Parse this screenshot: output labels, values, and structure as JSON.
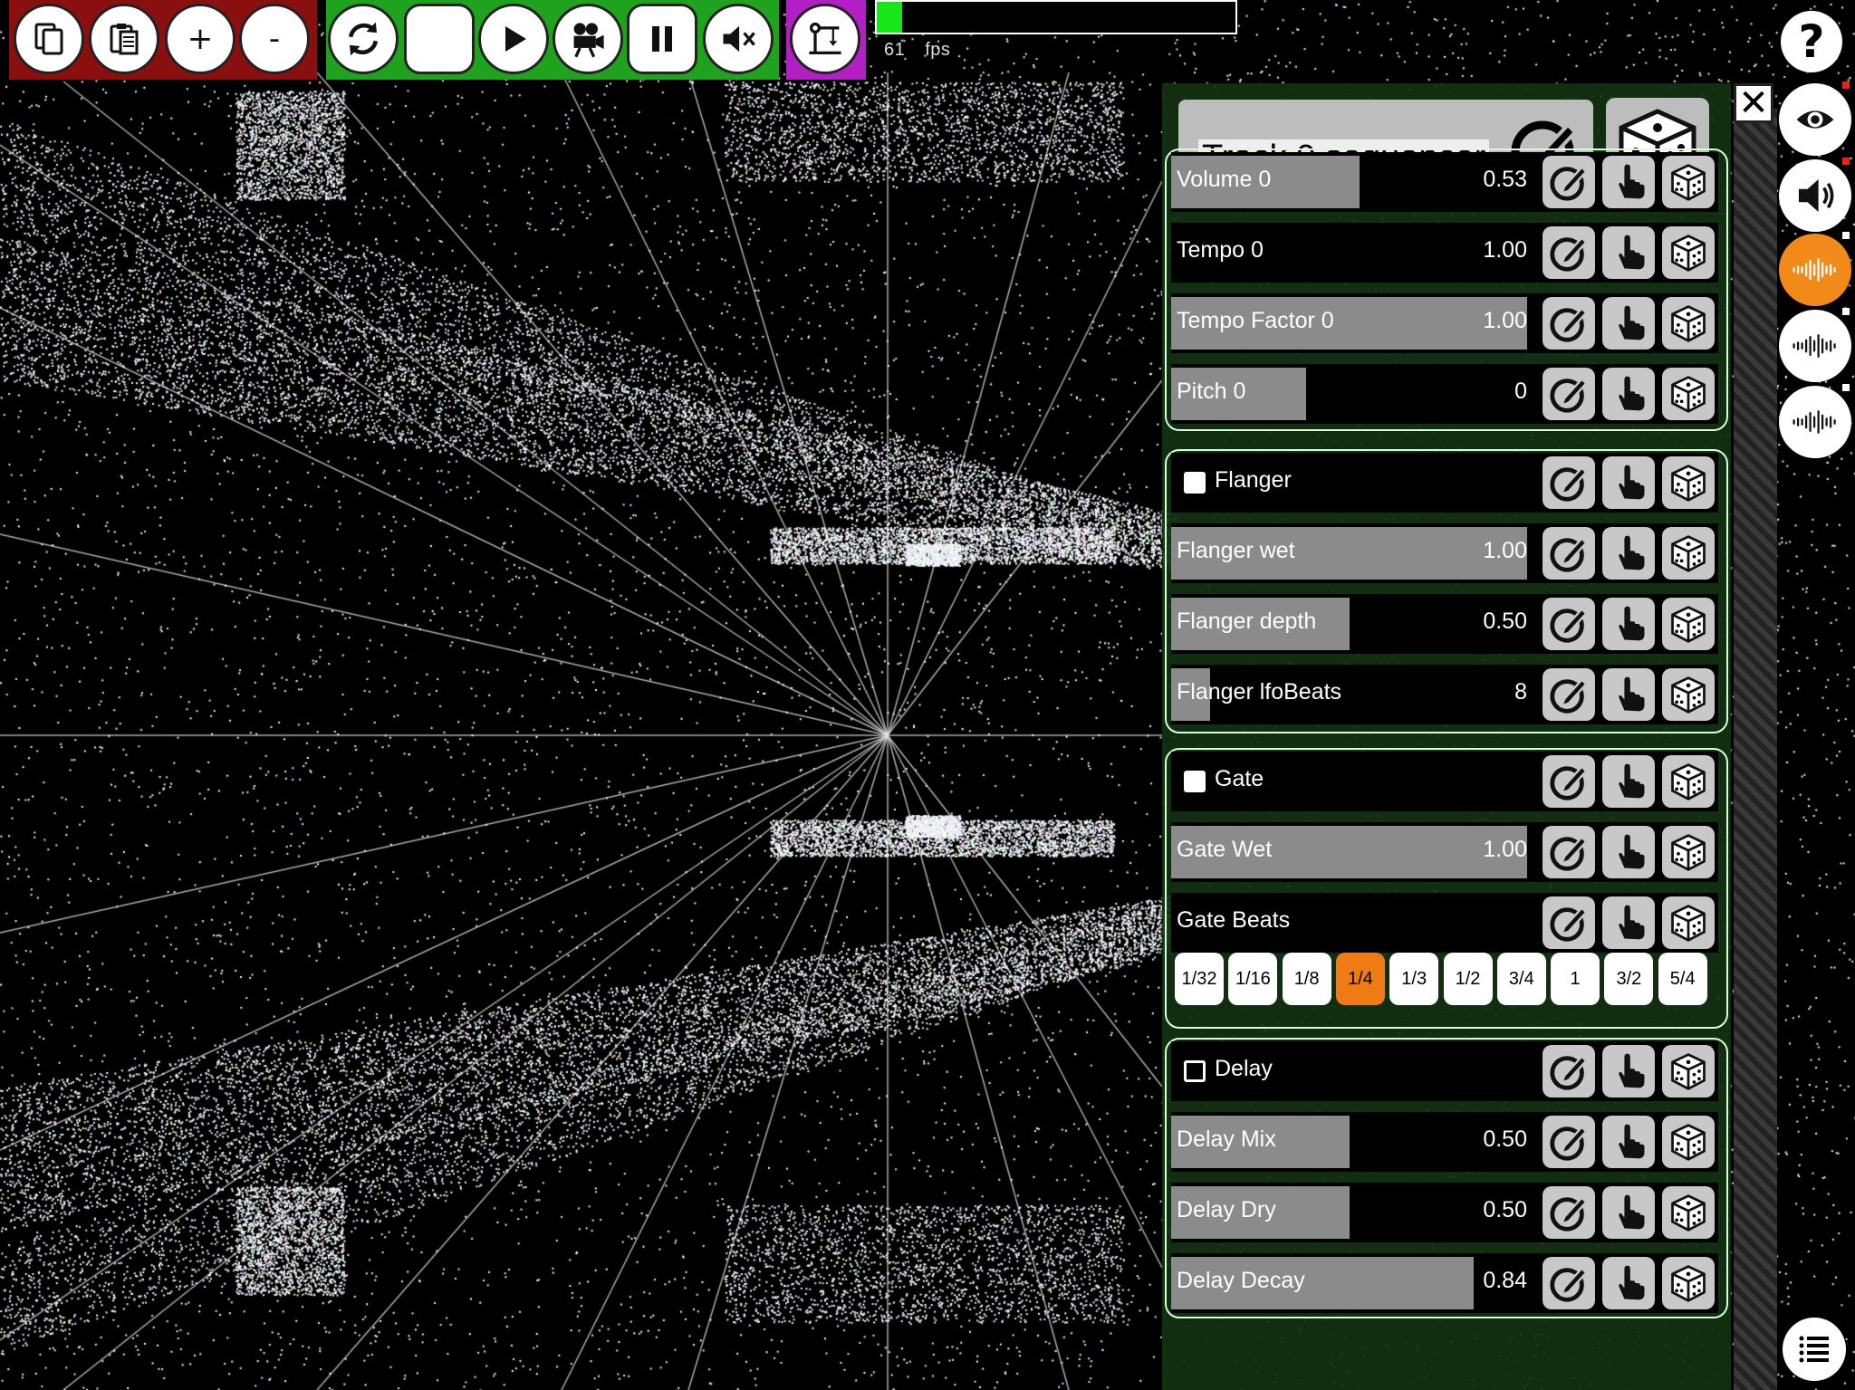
{
  "toolbar": {
    "buttons": [
      {
        "name": "copy-button",
        "icon": "copy-icon",
        "label": ""
      },
      {
        "name": "paste-button",
        "icon": "paste-icon",
        "label": ""
      },
      {
        "name": "add-button",
        "icon": "",
        "label": "+"
      },
      {
        "name": "remove-button",
        "icon": "",
        "label": "-"
      },
      {
        "name": "sync-button",
        "icon": "sync-icon",
        "label": ""
      },
      {
        "name": "record-button",
        "icon": "circle-icon",
        "label": ""
      },
      {
        "name": "play-button",
        "icon": "play-icon",
        "label": ""
      },
      {
        "name": "camera-button",
        "icon": "movie-camera-icon",
        "label": ""
      },
      {
        "name": "pause-button",
        "icon": "pause-icon",
        "label": ""
      },
      {
        "name": "mute-button",
        "icon": "mute-icon",
        "label": ""
      },
      {
        "name": "crane-button",
        "icon": "crane-icon",
        "label": ""
      }
    ],
    "progress_fraction": 0.07,
    "fps_value": "61",
    "fps_label": "fps",
    "help_label": "?"
  },
  "colors": {
    "group_red": "#8a0f0f",
    "group_green": "#1fa31f",
    "group_purple": "#b21fc4",
    "accent_orange": "#f07a14",
    "panel_bg": "#123212",
    "slider_fill": "#8b8b8b",
    "progress_fill": "#19e619"
  },
  "sidebar": {
    "buttons": [
      {
        "name": "view-button",
        "icon": "eye-icon",
        "active": false
      },
      {
        "name": "sound-button",
        "icon": "speaker-icon",
        "active": false
      },
      {
        "name": "waveform-1-button",
        "icon": "waveform-icon",
        "active": true
      },
      {
        "name": "waveform-2-button",
        "icon": "waveform-icon",
        "active": false
      },
      {
        "name": "waveform-3-button",
        "icon": "waveform-icon",
        "active": false
      }
    ],
    "list_icon": "list-icon"
  },
  "panel": {
    "close_label": "✕",
    "title": "Track 0 sequencer",
    "sections": [
      {
        "name": "track-section",
        "rows": [
          {
            "kind": "slider",
            "label": "Volume 0",
            "value": "0.53",
            "fraction": 0.53
          },
          {
            "kind": "slider",
            "label": "Tempo 0",
            "value": "1.00",
            "fraction": 0
          },
          {
            "kind": "slider",
            "label": "Tempo Factor 0",
            "value": "1.00",
            "fraction": 1
          },
          {
            "kind": "slider",
            "label": "Pitch 0",
            "value": "0",
            "fraction": 0.38
          }
        ]
      },
      {
        "name": "flanger-section",
        "rows": [
          {
            "kind": "toggle",
            "label": "Flanger",
            "checked": false
          },
          {
            "kind": "slider",
            "label": "Flanger wet",
            "value": "1.00",
            "fraction": 1
          },
          {
            "kind": "slider",
            "label": "Flanger depth",
            "value": "0.50",
            "fraction": 0.5
          },
          {
            "kind": "slider",
            "label": "Flanger lfoBeats",
            "value": "8",
            "fraction": 0.11
          }
        ]
      },
      {
        "name": "gate-section",
        "rows": [
          {
            "kind": "toggle",
            "label": "Gate",
            "checked": false
          },
          {
            "kind": "slider",
            "label": "Gate Wet",
            "value": "1.00",
            "fraction": 1
          },
          {
            "kind": "header",
            "label": "Gate Beats"
          },
          {
            "kind": "beats",
            "options": [
              "1/32",
              "1/16",
              "1/8",
              "1/4",
              "1/3",
              "1/2",
              "3/4",
              "1",
              "3/2",
              "5/4"
            ],
            "selected": "1/4"
          }
        ]
      },
      {
        "name": "delay-section",
        "rows": [
          {
            "kind": "toggle",
            "label": "Delay",
            "checked": false,
            "outline": true
          },
          {
            "kind": "slider",
            "label": "Delay Mix",
            "value": "0.50",
            "fraction": 0.5
          },
          {
            "kind": "slider",
            "label": "Delay Dry",
            "value": "0.50",
            "fraction": 0.5
          },
          {
            "kind": "slider",
            "label": "Delay Decay",
            "value": "0.84",
            "fraction": 0.85
          }
        ]
      }
    ]
  }
}
